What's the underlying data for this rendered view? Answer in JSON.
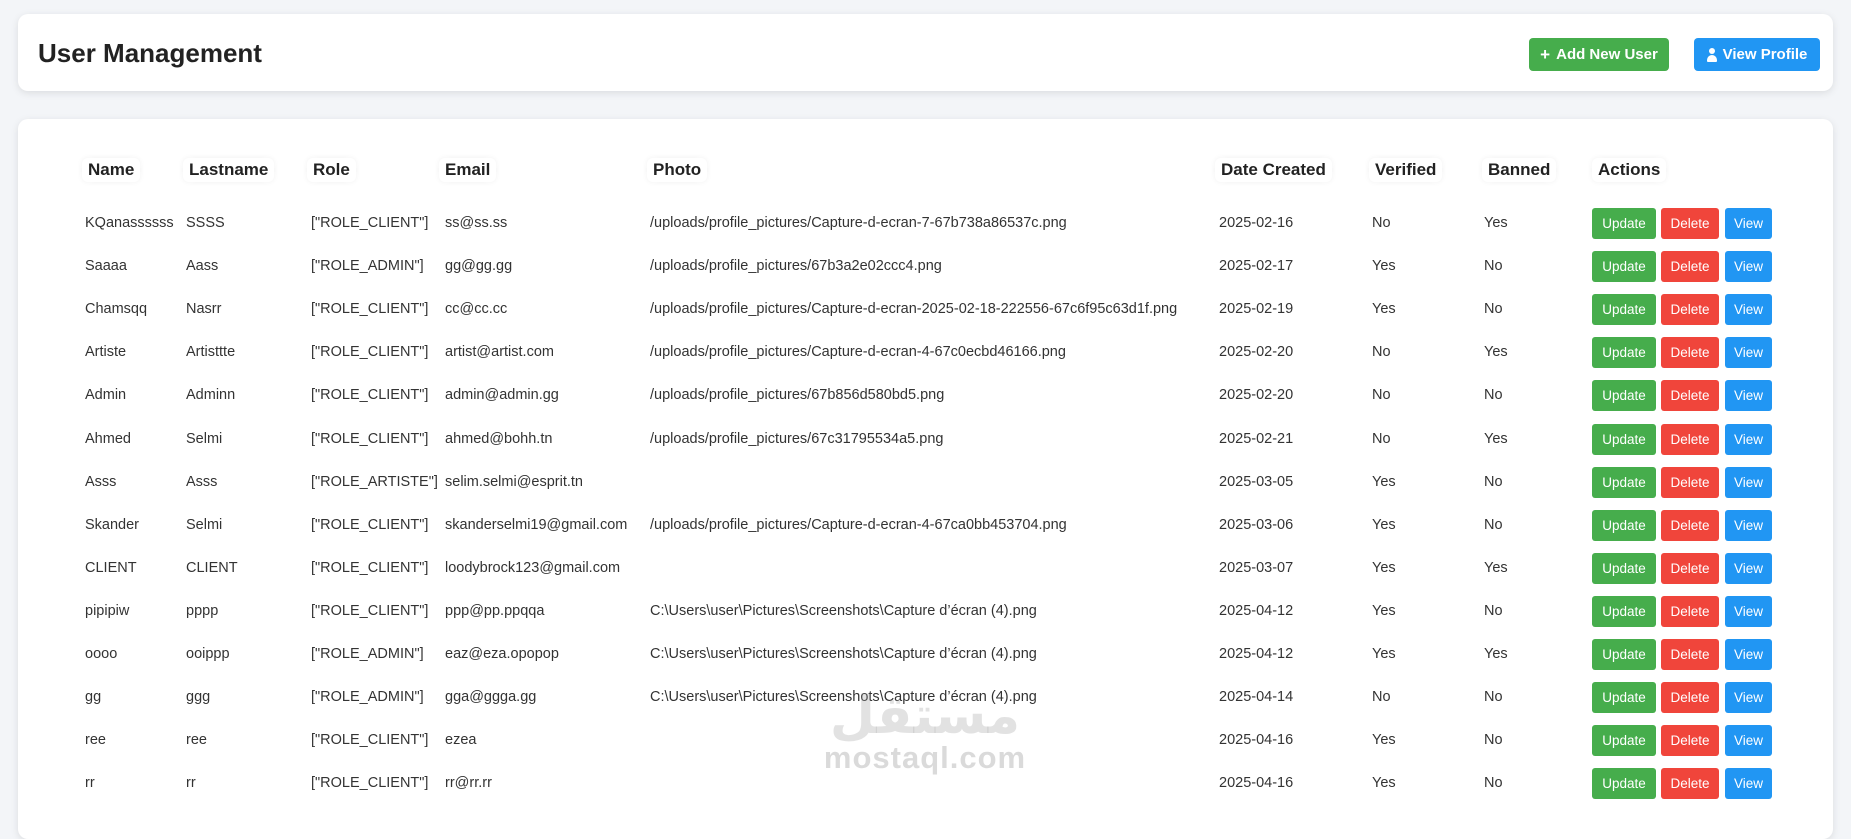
{
  "header": {
    "title": "User Management",
    "add_user_label": "Add New User",
    "view_profile_label": "View Profile"
  },
  "table": {
    "columns": [
      "Name",
      "Lastname",
      "Role",
      "Email",
      "Photo",
      "Date Created",
      "Verified",
      "Banned",
      "Actions"
    ],
    "action_labels": {
      "update": "Update",
      "delete": "Delete",
      "view": "View"
    },
    "rows": [
      [
        "KQanassssss",
        "SSSS",
        "[\"ROLE_CLIENT\"]",
        "ss@ss.ss",
        "/uploads/profile_pictures/Capture-d-ecran-7-67b738a86537c.png",
        "2025-02-16",
        "No",
        "Yes"
      ],
      [
        "Saaaa",
        "Aass",
        "[\"ROLE_ADMIN\"]",
        "gg@gg.gg",
        "/uploads/profile_pictures/67b3a2e02ccc4.png",
        "2025-02-17",
        "Yes",
        "No"
      ],
      [
        "Chamsqq",
        "Nasrr",
        "[\"ROLE_CLIENT\"]",
        "cc@cc.cc",
        "/uploads/profile_pictures/Capture-d-ecran-2025-02-18-222556-67c6f95c63d1f.png",
        "2025-02-19",
        "Yes",
        "No"
      ],
      [
        "Artiste",
        "Artisttte",
        "[\"ROLE_CLIENT\"]",
        "artist@artist.com",
        "/uploads/profile_pictures/Capture-d-ecran-4-67c0ecbd46166.png",
        "2025-02-20",
        "No",
        "Yes"
      ],
      [
        "Admin",
        "Adminn",
        "[\"ROLE_CLIENT\"]",
        "admin@admin.gg",
        "/uploads/profile_pictures/67b856d580bd5.png",
        "2025-02-20",
        "No",
        "No"
      ],
      [
        "Ahmed",
        "Selmi",
        "[\"ROLE_CLIENT\"]",
        "ahmed@bohh.tn",
        "/uploads/profile_pictures/67c31795534a5.png",
        "2025-02-21",
        "No",
        "Yes"
      ],
      [
        "Asss",
        "Asss",
        "[\"ROLE_ARTISTE\"]",
        "selim.selmi@esprit.tn",
        "",
        "2025-03-05",
        "Yes",
        "No"
      ],
      [
        "Skander",
        "Selmi",
        "[\"ROLE_CLIENT\"]",
        "skanderselmi19@gmail.com",
        "/uploads/profile_pictures/Capture-d-ecran-4-67ca0bb453704.png",
        "2025-03-06",
        "Yes",
        "No"
      ],
      [
        "CLIENT",
        "CLIENT",
        "[\"ROLE_CLIENT\"]",
        "loodybrock123@gmail.com",
        "",
        "2025-03-07",
        "Yes",
        "Yes"
      ],
      [
        "pipipiw",
        "pppp",
        "[\"ROLE_CLIENT\"]",
        "ppp@pp.ppqqa",
        "C:\\Users\\user\\Pictures\\Screenshots\\Capture d’écran (4).png",
        "2025-04-12",
        "Yes",
        "No"
      ],
      [
        "oooo",
        "ooippp",
        "[\"ROLE_ADMIN\"]",
        "eaz@eza.opopop",
        "C:\\Users\\user\\Pictures\\Screenshots\\Capture d’écran (4).png",
        "2025-04-12",
        "Yes",
        "Yes"
      ],
      [
        "gg",
        "ggg",
        "[\"ROLE_ADMIN\"]",
        "gga@ggga.gg",
        "C:\\Users\\user\\Pictures\\Screenshots\\Capture d’écran (4).png",
        "2025-04-14",
        "No",
        "No"
      ],
      [
        "ree",
        "ree",
        "[\"ROLE_CLIENT\"]",
        "ezea",
        "",
        "2025-04-16",
        "Yes",
        "No"
      ],
      [
        "rr",
        "rr",
        "[\"ROLE_CLIENT\"]",
        "rr@rr.rr",
        "",
        "2025-04-16",
        "Yes",
        "No"
      ]
    ]
  },
  "watermark": {
    "logo": "مستقل",
    "text": "mostaql.com"
  },
  "colors": {
    "success": "#46ad4c",
    "danger": "#f0453b",
    "primary": "#2196f3"
  },
  "icons": {
    "add": "plus-icon",
    "profile": "person-icon"
  }
}
